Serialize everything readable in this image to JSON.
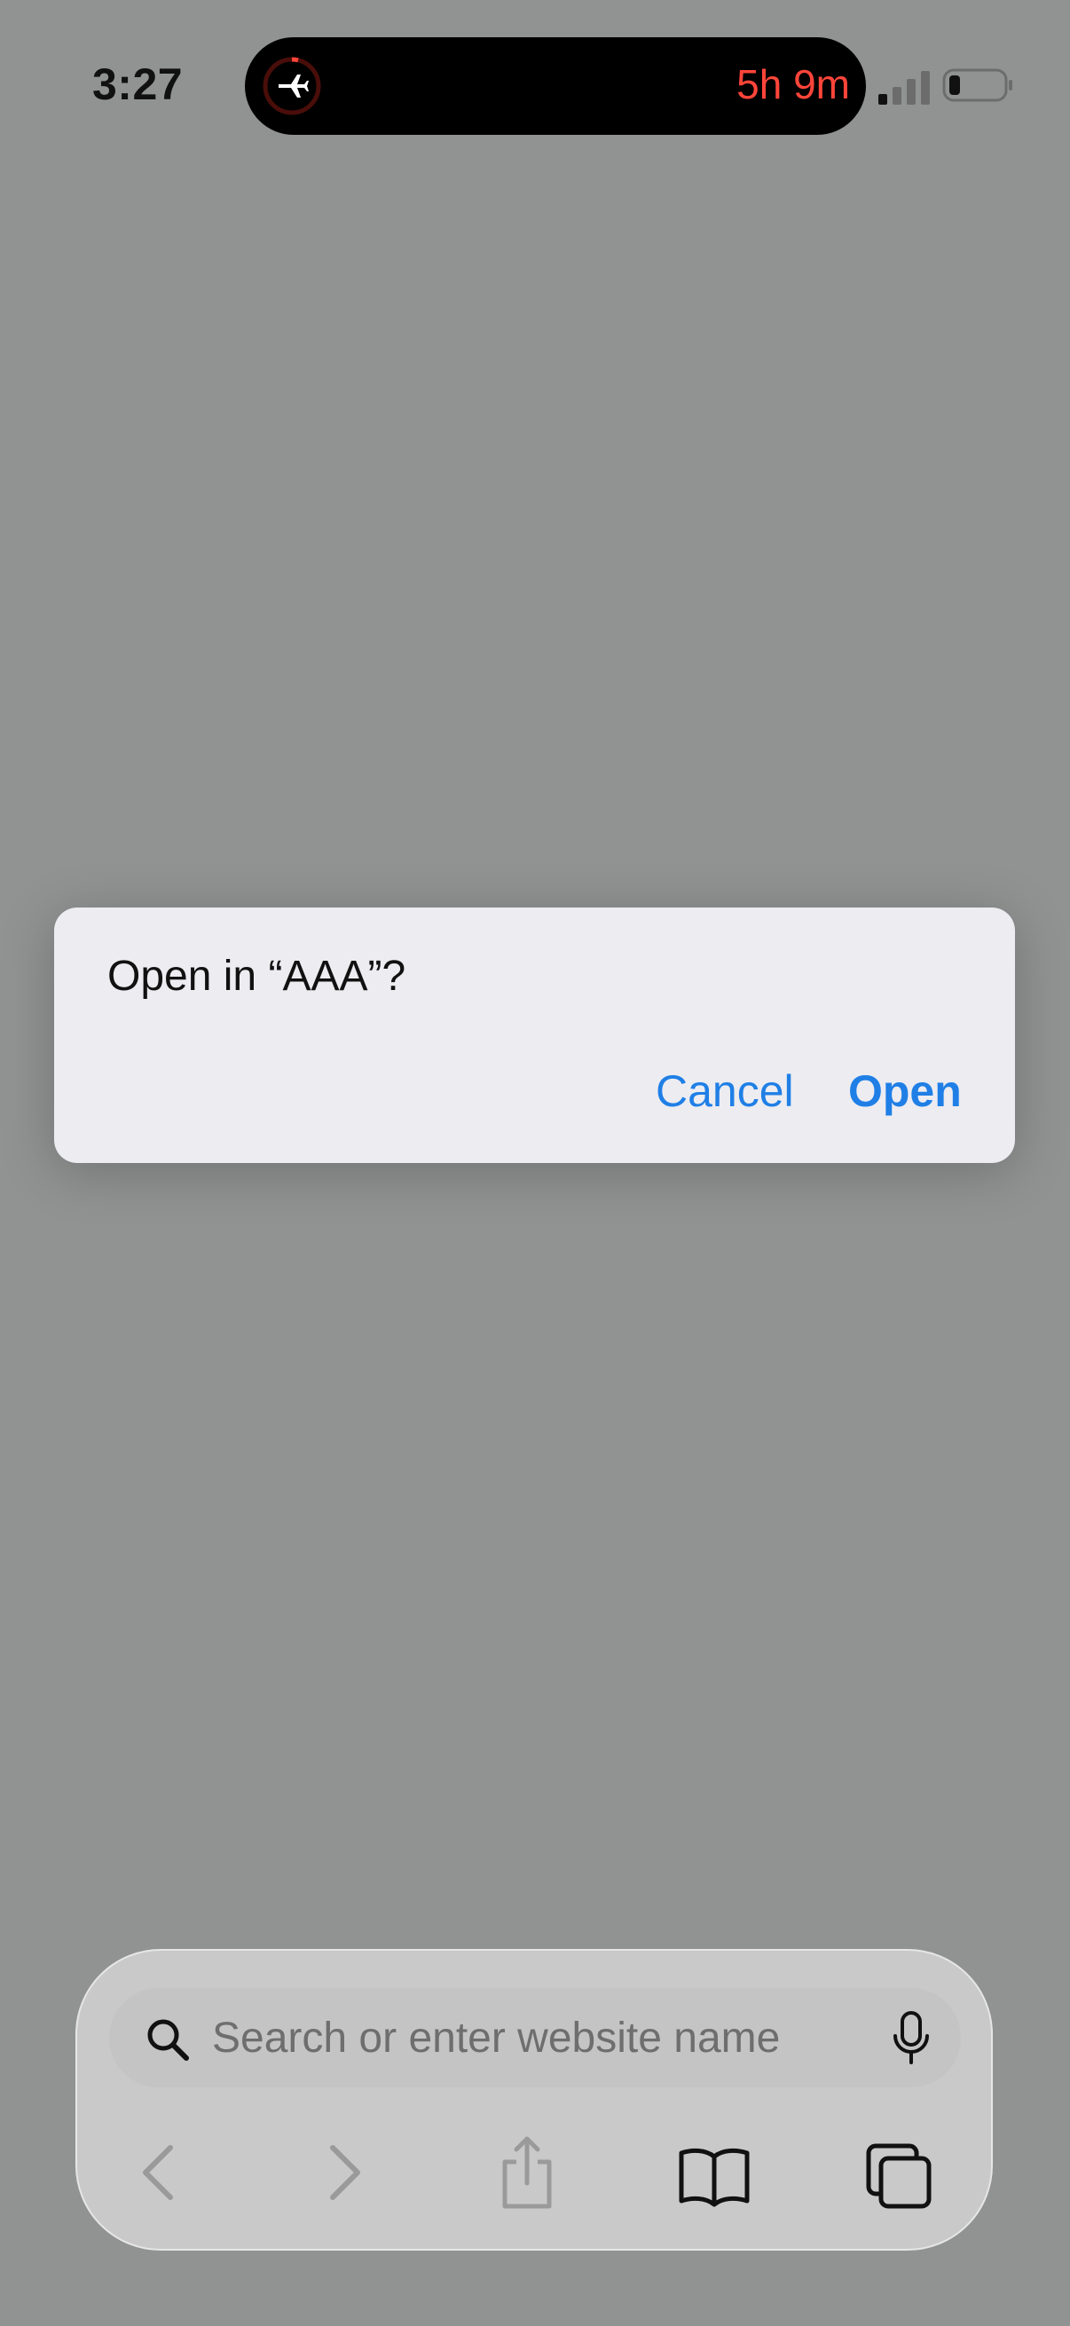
{
  "status_bar": {
    "time": "3:27",
    "island_activity": {
      "icon": "airplane-icon",
      "time_remaining": "5h 9m",
      "accent": "#ff453a"
    },
    "signal_icon": "cellular-signal-icon",
    "battery_icon": "battery-low-icon"
  },
  "dialog": {
    "title": "Open in “AAA”?",
    "cancel_label": "Cancel",
    "open_label": "Open",
    "accent": "#1f7fe6"
  },
  "toolbar": {
    "search_placeholder": "Search or enter website name",
    "search_icon": "search-icon",
    "mic_icon": "microphone-icon",
    "buttons": [
      "back-icon",
      "forward-icon",
      "share-icon",
      "bookmarks-icon",
      "tabs-icon"
    ]
  }
}
